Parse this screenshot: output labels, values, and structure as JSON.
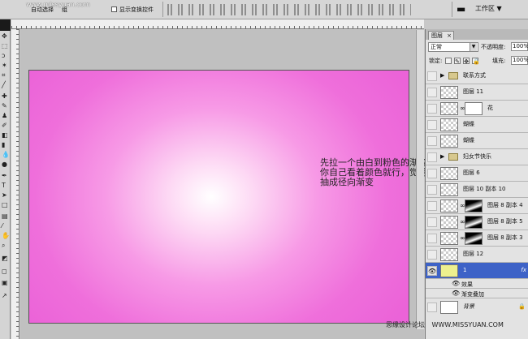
{
  "options_bar": {
    "watermark": "www.missyuan.com",
    "auto_select": "自动选择",
    "group": "组",
    "show_transform": "显示变换控件",
    "workspace": "工作区 ▼"
  },
  "canvas": {
    "note_lines": "先拉一个由白到粉色的渐变\n你自己看着颜色就行，觉得漂亮就行\n抽成径向渐变"
  },
  "layers_panel": {
    "tab_label": "图层",
    "blend_mode": "正常",
    "opacity_label": "不透明度:",
    "opacity_value": "100%",
    "lock_label": "锁定:",
    "fill_label": "填充:",
    "fill_value": "100%",
    "layers": [
      {
        "name": "联系方式",
        "type": "group"
      },
      {
        "name": "图层 11",
        "type": "layer"
      },
      {
        "name": "花",
        "type": "layer-mask"
      },
      {
        "name": "蝴蝶",
        "type": "layer"
      },
      {
        "name": "蝴蝶",
        "type": "layer"
      },
      {
        "name": "妇女节快乐",
        "type": "group"
      },
      {
        "name": "图层 6",
        "type": "layer"
      },
      {
        "name": "图层 10 副本 10",
        "type": "layer"
      },
      {
        "name": "图层 8 副本 4",
        "type": "layer-mask"
      },
      {
        "name": "图层 8 副本 5",
        "type": "layer-mask"
      },
      {
        "name": "图层 8 副本 3",
        "type": "layer-mask"
      },
      {
        "name": "图层 12",
        "type": "layer"
      },
      {
        "name": "1",
        "type": "active",
        "fx": "fx"
      }
    ],
    "effects_label": "效果",
    "effect_name": "渐变叠加",
    "background_name": "背景"
  },
  "footer": {
    "site1": "思缘设计论坛",
    "site2": "WWW.MISSYUAN.COM"
  }
}
